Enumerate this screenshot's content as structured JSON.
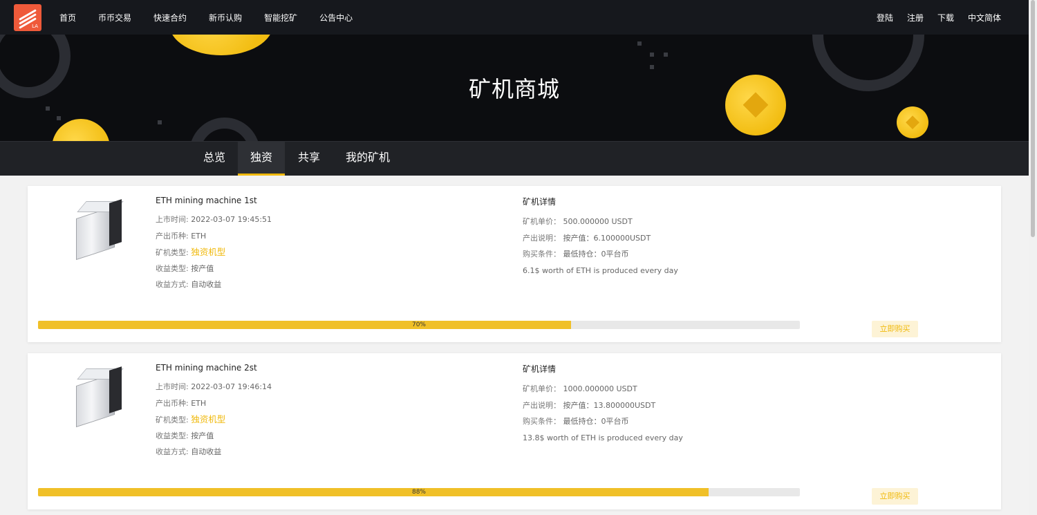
{
  "nav": {
    "logo_text": "LA",
    "links": [
      "首页",
      "币币交易",
      "快速合约",
      "新币认购",
      "智能挖矿",
      "公告中心"
    ],
    "right": [
      "登陆",
      "注册",
      "下载",
      "中文简体"
    ]
  },
  "banner": {
    "title": "矿机商城"
  },
  "tabs": [
    "总览",
    "独资",
    "共享",
    "我的矿机"
  ],
  "active_tab": "独资",
  "colors": {
    "accent": "#f0b90b",
    "nav_bg": "#16181d",
    "banner_bg": "#0c0d10"
  },
  "cards": [
    {
      "name": "ETH mining machine 1st",
      "launch_label": "上市时间:",
      "launch_time": "2022-03-07 19:45:51",
      "coin_label": "产出币种:",
      "coin": "ETH",
      "type_label": "矿机类型:",
      "type": "独资机型",
      "income_type_label": "收益类型:",
      "income_type": "按产值",
      "income_method_label": "收益方式:",
      "income_method": "自动收益",
      "details_title": "矿机详情",
      "price_label": "矿机单价：",
      "price": "500.000000 USDT",
      "output_label": "产出说明：",
      "output": "按产值：6.100000USDT",
      "condition_label": "购买条件：",
      "condition": "最低持仓：0平台币",
      "note": "6.1$ worth of ETH is produced every day",
      "progress": 70,
      "progress_label": "70%",
      "buy_label": "立即购买"
    },
    {
      "name": "ETH mining machine 2st",
      "launch_label": "上市时间:",
      "launch_time": "2022-03-07 19:46:14",
      "coin_label": "产出币种:",
      "coin": "ETH",
      "type_label": "矿机类型:",
      "type": "独资机型",
      "income_type_label": "收益类型:",
      "income_type": "按产值",
      "income_method_label": "收益方式:",
      "income_method": "自动收益",
      "details_title": "矿机详情",
      "price_label": "矿机单价：",
      "price": "1000.000000 USDT",
      "output_label": "产出说明：",
      "output": "按产值：13.800000USDT",
      "condition_label": "购买条件：",
      "condition": "最低持仓：0平台币",
      "note": "13.8$ worth of ETH is produced every day",
      "progress": 88,
      "progress_label": "88%",
      "buy_label": "立即购买"
    }
  ]
}
